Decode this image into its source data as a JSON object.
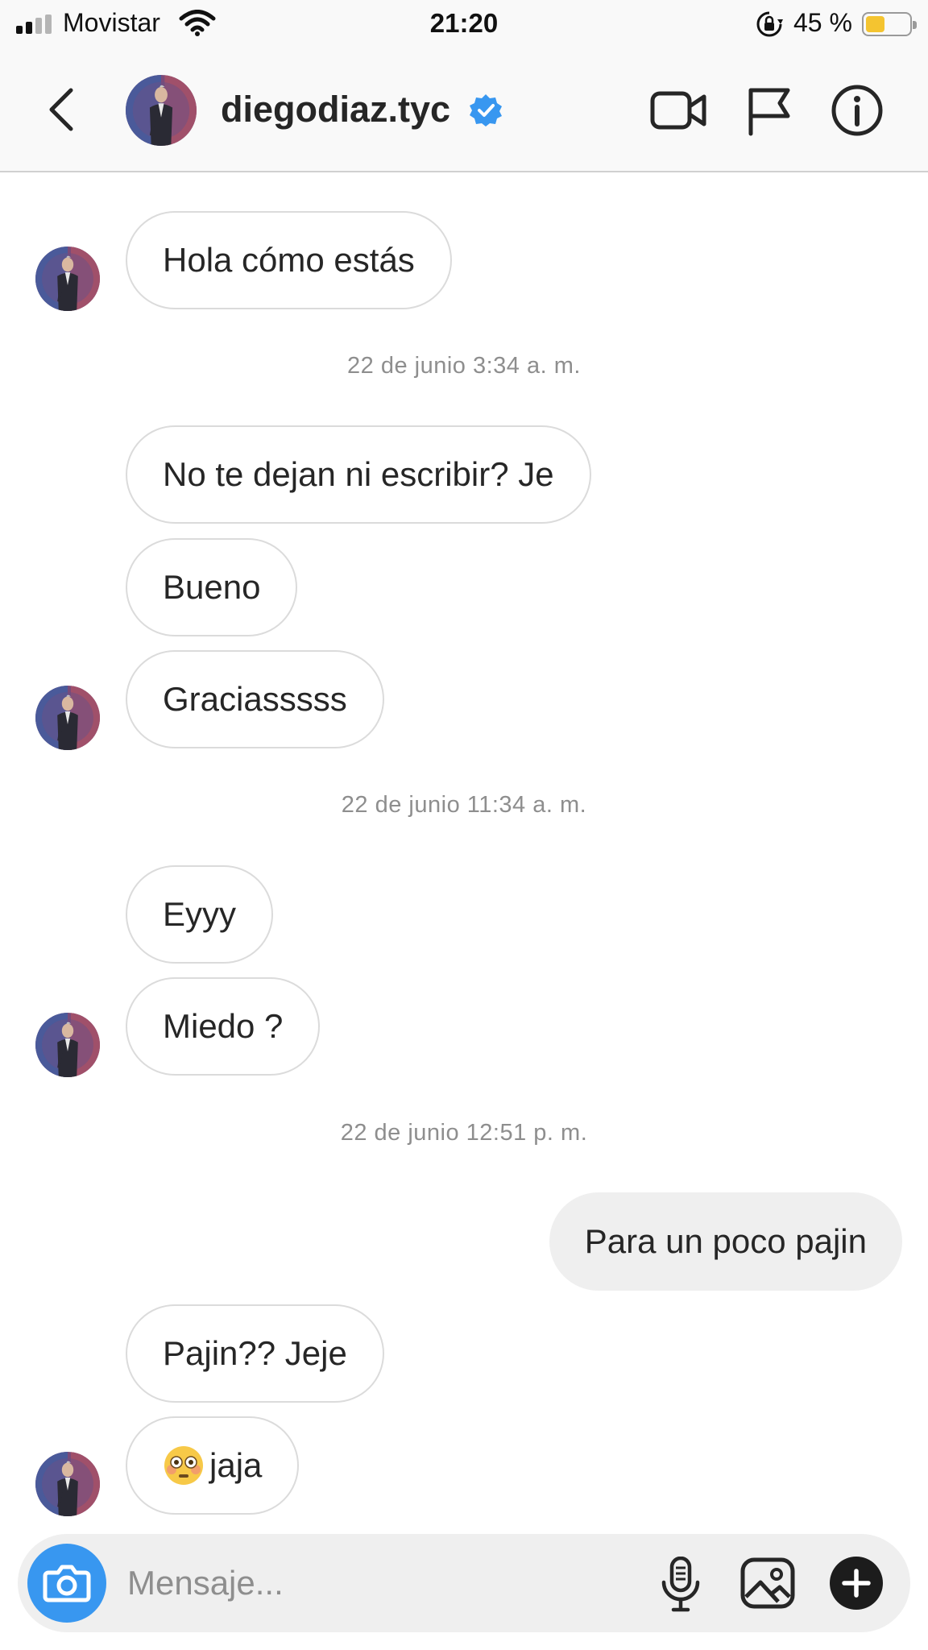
{
  "status_bar": {
    "carrier": "Movistar",
    "time": "21:20",
    "battery_percent": "45 %",
    "battery_level": 0.45,
    "signal_bars": 2,
    "icons": [
      "signal-icon",
      "wifi-icon",
      "rotation-lock-icon",
      "battery-icon"
    ]
  },
  "header": {
    "username": "diegodiaz.tyc",
    "verified": true,
    "icons": [
      "back-chevron-icon",
      "video-call-icon",
      "flag-icon",
      "info-icon"
    ]
  },
  "messages": [
    {
      "text": "Hola cómo estás"
    },
    {
      "timestamp": "22 de junio 3:34 a. m."
    },
    {
      "text": "No te dejan ni escribir? Je"
    },
    {
      "text": "Bueno"
    },
    {
      "text": "Graciasssss"
    },
    {
      "timestamp": "22 de junio 11:34 a. m."
    },
    {
      "text": "Eyyy"
    },
    {
      "text": "Miedo ?"
    },
    {
      "timestamp": "22 de junio 12:51 p. m."
    },
    {
      "text": "Para un poco pajin"
    },
    {
      "text": "Pajin?? Jeje"
    },
    {
      "text": "jaja",
      "emoji": "flushed-face-icon"
    }
  ],
  "composer": {
    "placeholder": "Mensaje...",
    "icons": [
      "camera-icon",
      "microphone-icon",
      "gallery-icon",
      "plus-icon"
    ]
  },
  "colors": {
    "accent_blue": "#3897f0",
    "verified_blue": "#3897f0",
    "incoming_border": "#dbdbdb",
    "outgoing_bubble": "#efefef",
    "timestamp_gray": "#8e8e8e",
    "battery_yellow": "#f4c430"
  }
}
